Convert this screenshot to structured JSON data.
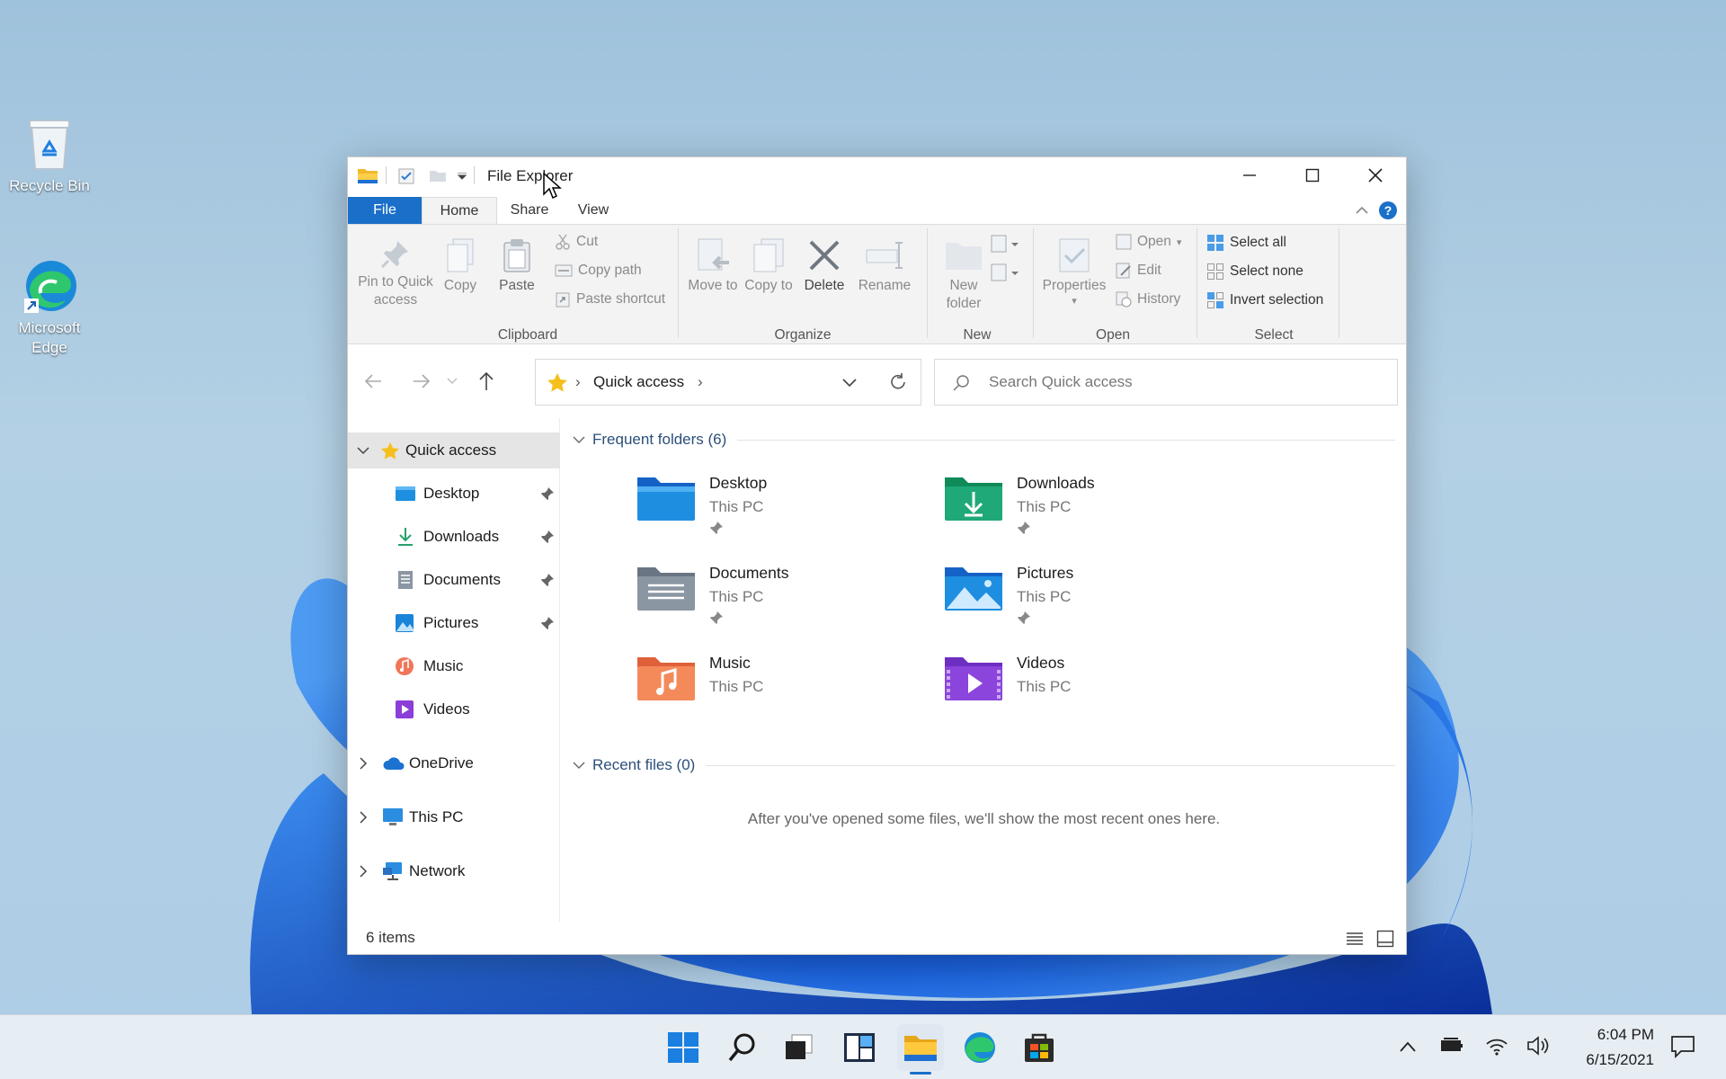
{
  "desktop": {
    "icons": [
      {
        "label": "Recycle Bin",
        "icon": "recycle-bin-icon"
      },
      {
        "label": "Microsoft Edge",
        "icon": "edge-icon"
      }
    ]
  },
  "window": {
    "title": "File Explorer",
    "tabs": [
      "File",
      "Home",
      "Share",
      "View"
    ],
    "active_tab": "Home",
    "accent": "#1a6fc9"
  },
  "ribbon": {
    "clipboard": {
      "pin": "Pin to Quick access",
      "copy": "Copy",
      "paste": "Paste",
      "cut": "Cut",
      "copy_path": "Copy path",
      "paste_shortcut": "Paste shortcut",
      "label": "Clipboard"
    },
    "organize": {
      "move_to": "Move to",
      "copy_to": "Copy to",
      "delete": "Delete",
      "rename": "Rename",
      "label": "Organize"
    },
    "new": {
      "new_folder": "New folder",
      "label": "New"
    },
    "open": {
      "properties": "Properties",
      "open": "Open",
      "edit": "Edit",
      "history": "History",
      "label": "Open"
    },
    "select": {
      "select_all": "Select all",
      "select_none": "Select none",
      "invert": "Invert selection",
      "label": "Select"
    }
  },
  "navbar": {
    "address": "Quick access",
    "search_placeholder": "Search Quick access"
  },
  "nav_pane": {
    "quick_access": "Quick access",
    "items": [
      "Desktop",
      "Downloads",
      "Documents",
      "Pictures",
      "Music",
      "Videos"
    ],
    "onedrive": "OneDrive",
    "this_pc": "This PC",
    "network": "Network"
  },
  "content": {
    "frequent_header": "Frequent folders (6)",
    "folders": [
      {
        "name": "Desktop",
        "location": "This PC",
        "pinned": true
      },
      {
        "name": "Downloads",
        "location": "This PC",
        "pinned": true
      },
      {
        "name": "Documents",
        "location": "This PC",
        "pinned": true
      },
      {
        "name": "Pictures",
        "location": "This PC",
        "pinned": true
      },
      {
        "name": "Music",
        "location": "This PC",
        "pinned": false
      },
      {
        "name": "Videos",
        "location": "This PC",
        "pinned": false
      }
    ],
    "recent_header": "Recent files (0)",
    "recent_empty": "After you've opened some files, we'll show the most recent ones here."
  },
  "status": {
    "items": "6 items"
  },
  "taskbar": {
    "time": "6:04 PM",
    "date": "6/15/2021"
  }
}
